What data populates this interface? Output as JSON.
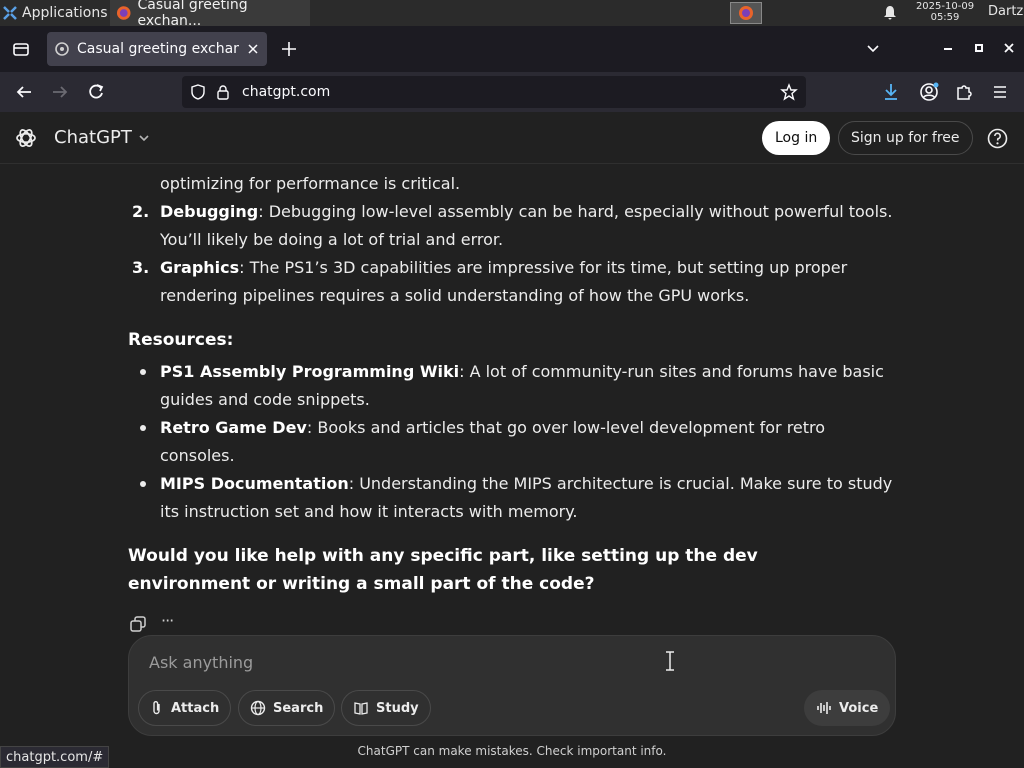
{
  "taskbar": {
    "applications_label": "Applications",
    "task_title": "Casual greeting exchan...",
    "clock_date": "2025-10-09",
    "clock_time": "05:59",
    "user": "Dartz"
  },
  "browser": {
    "tab_title": "Casual greeting exchang",
    "url": "chatgpt.com",
    "status_link": "chatgpt.com/#"
  },
  "header": {
    "brand": "ChatGPT",
    "login_label": "Log in",
    "signup_label": "Sign up for free"
  },
  "message": {
    "partial_line": "optimizing for performance is critical.",
    "challenges": [
      {
        "num": "2.",
        "term": "Debugging",
        "line1": ": Debugging low-level assembly can be hard, especially without powerful tools.",
        "line2": "You’ll likely be doing a lot of trial and error."
      },
      {
        "num": "3.",
        "term": "Graphics",
        "line1": ": The PS1’s 3D capabilities are impressive for its time, but setting up proper",
        "line2": "rendering pipelines requires a solid understanding of how the GPU works."
      }
    ],
    "resources_heading": "Resources:",
    "resources": [
      {
        "term": "PS1 Assembly Programming Wiki",
        "line1": ": A lot of community-run sites and forums have basic",
        "line2": "guides and code snippets."
      },
      {
        "term": "Retro Game Dev",
        "line1": ": Books and articles that go over low-level development for retro",
        "line2": "consoles."
      },
      {
        "term": "MIPS Documentation",
        "line1": ": Understanding the MIPS architecture is crucial. Make sure to study",
        "line2": "its instruction set and how it interacts with memory."
      }
    ],
    "question_line1": "Would you like help with any specific part, like setting up the dev",
    "question_line2": "environment or writing a small part of the code?",
    "more_label": "···"
  },
  "composer": {
    "placeholder": "Ask anything",
    "attach_label": "Attach",
    "search_label": "Search",
    "study_label": "Study",
    "voice_label": "Voice"
  },
  "footer": {
    "disclaimer": "ChatGPT can make mistakes. Check important info."
  },
  "colors": {
    "page_bg": "#212121",
    "composer_bg": "#303030",
    "text": "#ececec",
    "login_bg": "#ffffff"
  }
}
